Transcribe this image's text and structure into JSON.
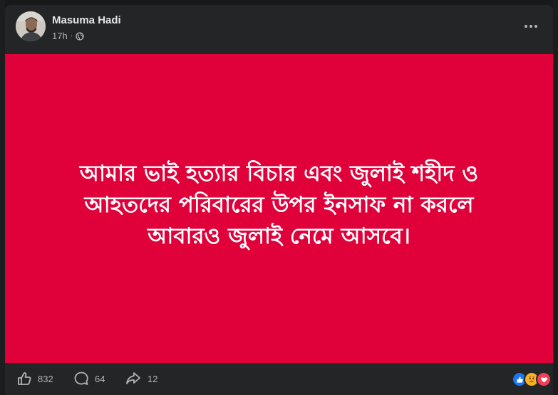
{
  "post": {
    "author": "Masuma Hadi",
    "time": "17h",
    "separator": "·",
    "privacy_icon": "globe-icon",
    "text_lines": [
      "আমার ভাই হত্যার বিচার এবং জুলাই শহীদ ও",
      "আহতদের পরিবারের উপর ইনসাফ না করলে",
      "আবারও জুলাই নেমে আসবে।"
    ],
    "background_color": "#e0003a"
  },
  "footer": {
    "like_count": "832",
    "comment_count": "64",
    "share_count": "12",
    "reaction_icons": [
      "like-reaction-icon",
      "sad-reaction-icon",
      "love-reaction-icon"
    ]
  },
  "colors": {
    "card_bg": "#242526",
    "page_bg": "#18191a",
    "primary_text": "#e4e6eb",
    "secondary_text": "#b0b3b8",
    "like_blue": "#1877f2",
    "love_red": "#f33e58",
    "sad_yellow": "#f7b125"
  }
}
